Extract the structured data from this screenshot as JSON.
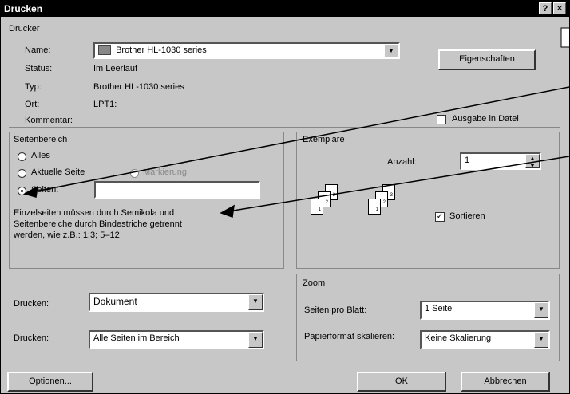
{
  "window": {
    "title": "Drucken",
    "help_btn": "?",
    "close_btn": "✕"
  },
  "printer": {
    "section": "Drucker",
    "name_label": "Name:",
    "name_value": "Brother HL-1030 series",
    "properties_button": "Eigenschaften",
    "status_label": "Status:",
    "status_value": "Im Leerlauf",
    "type_label": "Typ:",
    "type_value": "Brother HL-1030 series",
    "location_label": "Ort:",
    "location_value": "LPT1:",
    "comment_label": "Kommentar:",
    "print_to_file": "Ausgabe in Datei"
  },
  "range": {
    "section": "Seitenbereich",
    "all": "Alles",
    "current": "Aktuelle Seite",
    "selection": "Markierung",
    "pages": "Seiten:",
    "pages_value": "",
    "hint": [
      "Einzelseiten müssen durch Semikola und",
      "Seitenbereiche durch Bindestriche getrennt",
      "werden, wie z.B.: 1;3; 5–12"
    ]
  },
  "copies": {
    "section": "Exemplare",
    "count_label": "Anzahl:",
    "count_value": "1",
    "collate": "Sortieren"
  },
  "print_what": {
    "label": "Drucken:",
    "value": "Dokument"
  },
  "print_scope": {
    "label": "Drucken:",
    "value": "Alle Seiten im Bereich"
  },
  "zoom": {
    "section": "Zoom",
    "pages_per_sheet_label": "Seiten pro Blatt:",
    "pages_per_sheet_value": "1 Seite",
    "scale_label": "Papierformat skalieren:",
    "scale_value": "Keine Skalierung"
  },
  "buttons": {
    "options": "Optionen...",
    "ok": "OK",
    "cancel": "Abbrechen"
  },
  "page_icons": {
    "p1": "1",
    "p2": "2",
    "p3": "3"
  }
}
